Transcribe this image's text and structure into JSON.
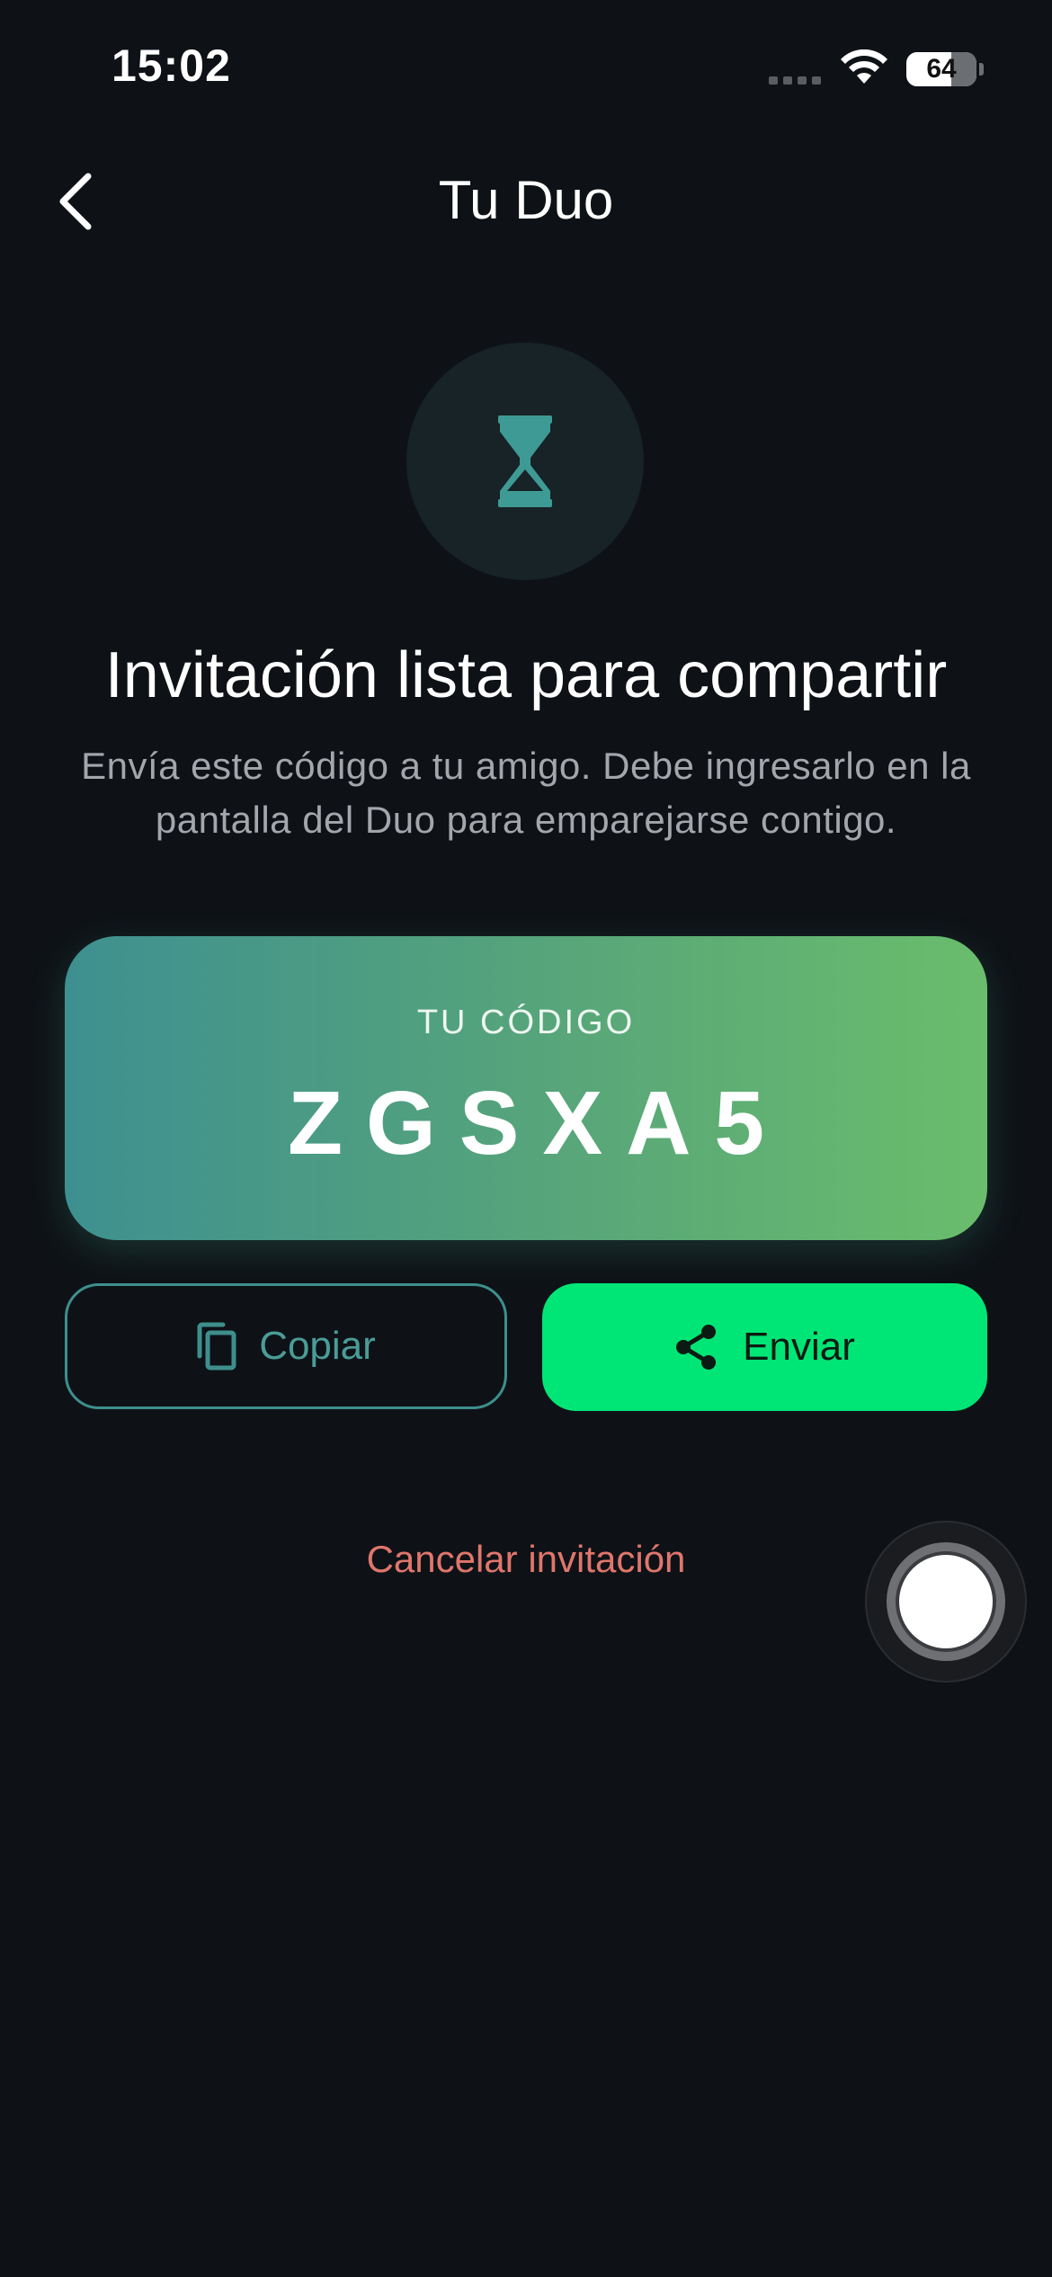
{
  "status_bar": {
    "time": "15:02",
    "battery_level": "64",
    "battery_fraction": 0.64
  },
  "nav": {
    "title": "Tu Duo",
    "back_icon": "chevron-left-icon"
  },
  "status_icon": "hourglass-icon",
  "headline": "Invitación lista para compartir",
  "subtext": "Envía este código a tu amigo. Debe ingresarlo en la pantalla del Duo para emparejarse contigo.",
  "code_card": {
    "label": "TU CÓDIGO",
    "code": "ZGSXA5"
  },
  "actions": {
    "copy_label": "Copiar",
    "copy_icon": "copy-icon",
    "send_label": "Enviar",
    "send_icon": "share-icon"
  },
  "cancel_label": "Cancelar invitación",
  "colors": {
    "background": "#0e1217",
    "accent_green": "#00e676",
    "teal": "#3e8f8c",
    "cancel_red": "#e0766c",
    "card_gradient_start": "#3e9090",
    "card_gradient_end": "#6abd6c"
  }
}
